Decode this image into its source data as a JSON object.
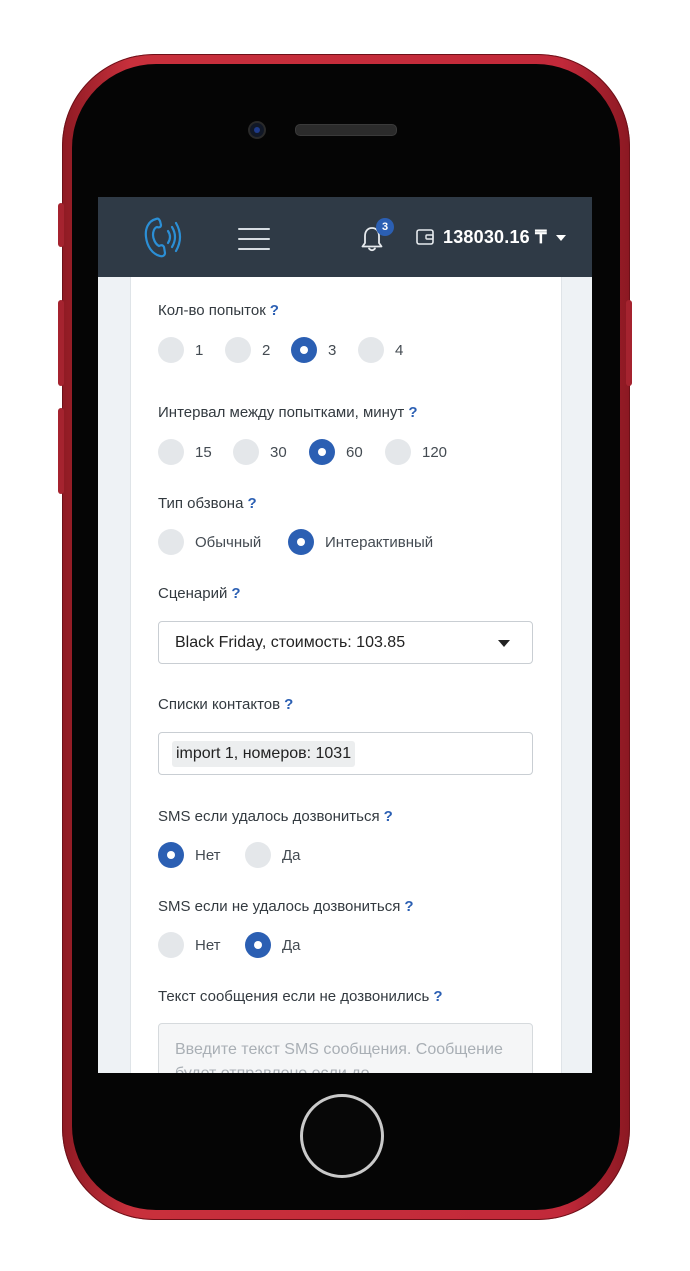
{
  "navbar": {
    "notifications_count": "3",
    "balance": "138030.16 ₸"
  },
  "form": {
    "attempts": {
      "label": "Кол-во попыток",
      "help": "?",
      "options": [
        "1",
        "2",
        "3",
        "4"
      ],
      "selected": "3"
    },
    "interval": {
      "label": "Интервал между попытками, минут",
      "help": "?",
      "options": [
        "15",
        "30",
        "60",
        "120"
      ],
      "selected": "60"
    },
    "call_type": {
      "label": "Тип обзвона",
      "help": "?",
      "options": [
        "Обычный",
        "Интерактивный"
      ],
      "selected": "Интерактивный"
    },
    "scenario": {
      "label": "Сценарий",
      "help": "?",
      "value": "Black Friday, стоимость: 103.85"
    },
    "contact_lists": {
      "label": "Списки контактов",
      "help": "?",
      "chips": [
        "import 1, номеров: 1031"
      ]
    },
    "sms_success": {
      "label": "SMS если удалось дозвониться",
      "help": "?",
      "options": [
        "Нет",
        "Да"
      ],
      "selected": "Нет"
    },
    "sms_fail": {
      "label": "SMS если не удалось дозвониться",
      "help": "?",
      "options": [
        "Нет",
        "Да"
      ],
      "selected": "Да"
    },
    "message": {
      "label": "Текст сообщения если не дозвонились",
      "help": "?",
      "placeholder": "Введите текст SMS сообщения. Сообщение будет отправлено если до"
    }
  },
  "colors": {
    "navbar": "#2f3a46",
    "accent": "#2b5fb3",
    "phone_frame": "#c2293a"
  }
}
